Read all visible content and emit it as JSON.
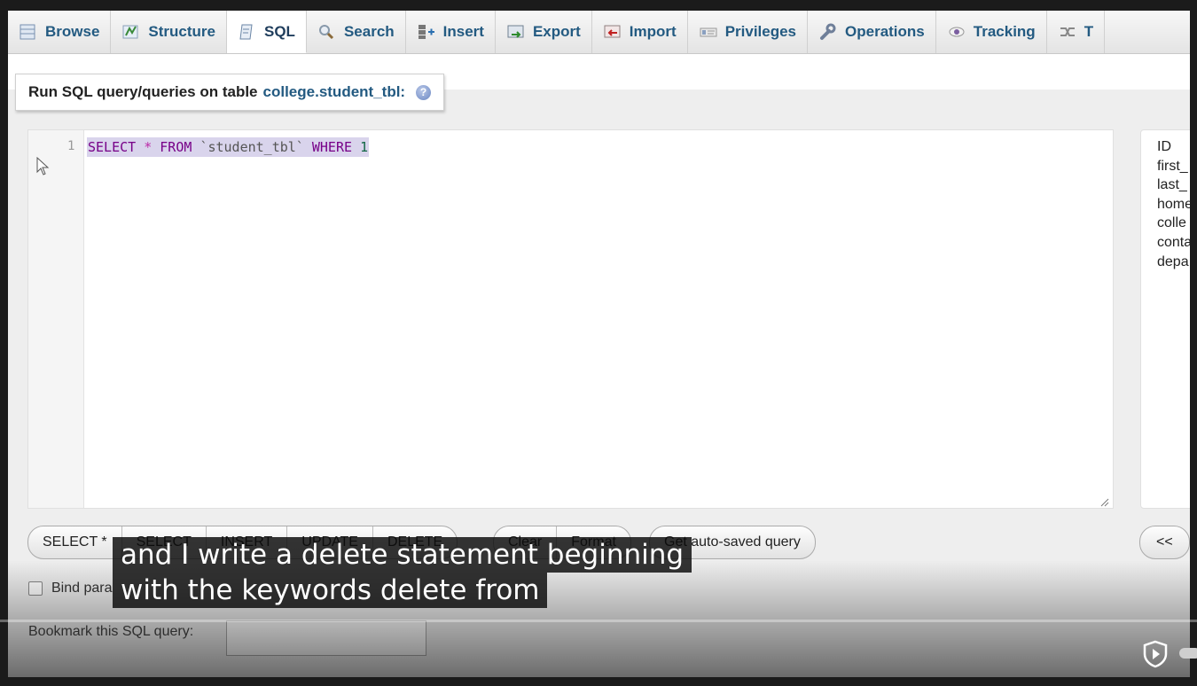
{
  "tabs": [
    {
      "label": "Browse",
      "icon": "browse-icon"
    },
    {
      "label": "Structure",
      "icon": "structure-icon"
    },
    {
      "label": "SQL",
      "icon": "sql-icon",
      "active": true
    },
    {
      "label": "Search",
      "icon": "search-icon"
    },
    {
      "label": "Insert",
      "icon": "insert-icon"
    },
    {
      "label": "Export",
      "icon": "export-icon"
    },
    {
      "label": "Import",
      "icon": "import-icon"
    },
    {
      "label": "Privileges",
      "icon": "privileges-icon"
    },
    {
      "label": "Operations",
      "icon": "operations-icon"
    },
    {
      "label": "Tracking",
      "icon": "tracking-icon"
    },
    {
      "label": "T",
      "icon": "triggers-icon"
    }
  ],
  "legend": {
    "prefix": "Run SQL query/queries on table",
    "table": "college.student_tbl:"
  },
  "editor": {
    "line_number": "1",
    "tokens": {
      "select": "SELECT",
      "star": "*",
      "from": "FROM",
      "table": "`student_tbl`",
      "where": "WHERE",
      "one": "1"
    }
  },
  "columns": [
    "ID",
    "first_",
    "last_",
    "home",
    "colle",
    "conta",
    "depa"
  ],
  "query_buttons": {
    "group1": [
      "SELECT *",
      "SELECT",
      "INSERT",
      "UPDATE",
      "DELETE"
    ],
    "group2": [
      "Clear",
      "Format"
    ],
    "autosaved": "Get auto-saved query",
    "collapse": "<<"
  },
  "bind_params_label": "Bind para",
  "bookmark_label": "Bookmark this SQL query:",
  "subtitle": {
    "line1": "and I write a delete statement beginning",
    "line2": "with the keywords delete from"
  },
  "colors": {
    "accent": "#235a81",
    "selection": "#d9d4ec",
    "keyword": "#770088"
  }
}
